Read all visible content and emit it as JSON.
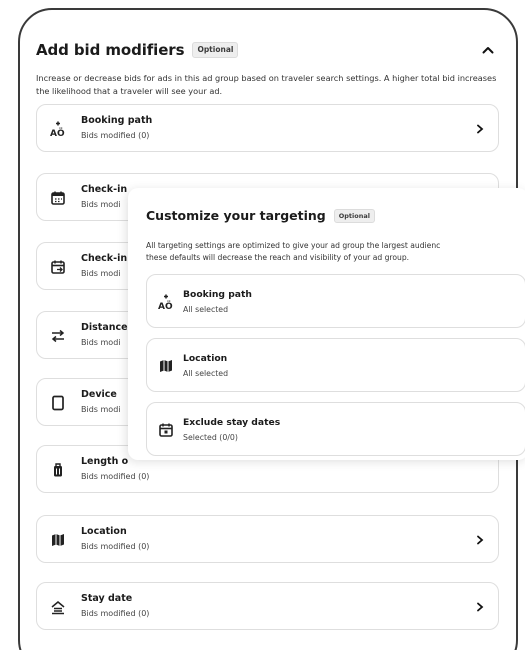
{
  "panel": {
    "title": "Add bid modifiers",
    "badge": "Optional",
    "description": "Increase or decrease bids for ads in this ad group based on traveler search settings. A higher total bid increases the likelihood that a traveler will see your ad."
  },
  "modifiers": [
    {
      "label": "Booking path",
      "sub": "Bids modified (0)",
      "icon": "booking-path-icon"
    },
    {
      "label": "Check-in",
      "sub": "Bids modi",
      "icon": "calendar-icon"
    },
    {
      "label": "Check-in",
      "sub": "Bids modi",
      "icon": "calendar-arrow-icon"
    },
    {
      "label": "Distance",
      "sub": "Bids modi",
      "icon": "distance-arrows-icon"
    },
    {
      "label": "Device",
      "sub": "Bids modi",
      "icon": "device-icon"
    },
    {
      "label": "Length o",
      "sub": "Bids modified (0)",
      "icon": "luggage-icon"
    },
    {
      "label": "Location",
      "sub": "Bids modified (0)",
      "icon": "map-icon"
    },
    {
      "label": "Stay date",
      "sub": "Bids modified (0)",
      "icon": "stay-date-icon"
    }
  ],
  "overlay": {
    "title": "Customize your targeting",
    "badge": "Optional",
    "description_line1": "All targeting settings are optimized to give your ad group the largest audienc",
    "description_line2": "these defaults will decrease the reach and visibility of your ad group.",
    "items": [
      {
        "label": "Booking path",
        "sub": "All selected",
        "icon": "booking-path-icon"
      },
      {
        "label": "Location",
        "sub": "All selected",
        "icon": "map-icon"
      },
      {
        "label": "Exclude stay dates",
        "sub": "Selected (0/0)",
        "icon": "calendar-dot-icon"
      }
    ]
  },
  "colors": {
    "border": "#dedede",
    "text": "#1b1b1b",
    "frame": "#3a3a3a"
  }
}
